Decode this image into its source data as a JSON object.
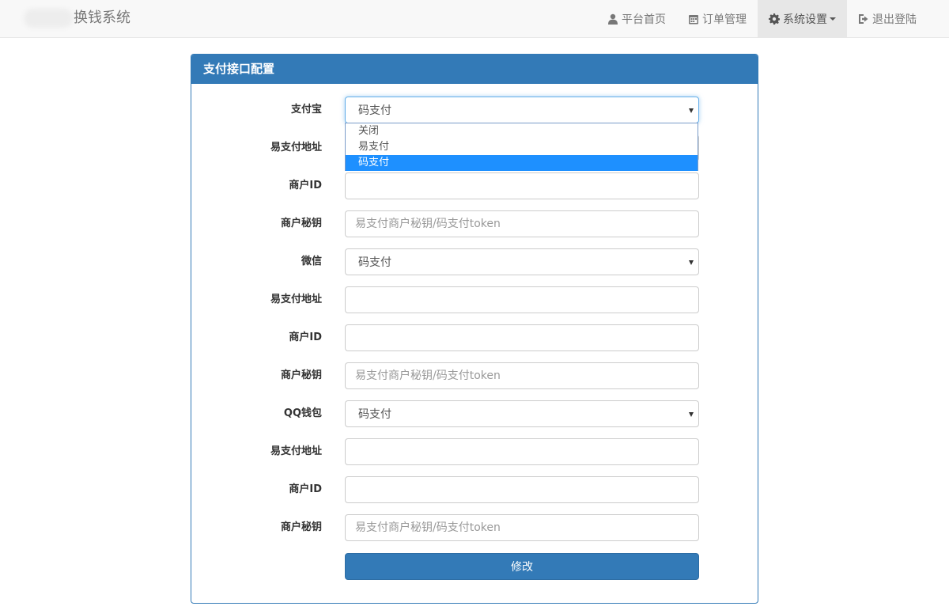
{
  "brand": {
    "title": "换钱系统"
  },
  "nav": {
    "items": [
      {
        "label": "平台首页",
        "icon": "user-icon"
      },
      {
        "label": "订单管理",
        "icon": "calendar-icon"
      },
      {
        "label": "系统设置",
        "icon": "gear-icon",
        "active": true,
        "dropdown": true
      },
      {
        "label": "退出登陆",
        "icon": "logout-icon"
      }
    ]
  },
  "panel": {
    "title": "支付接口配置",
    "alipay": {
      "label": "支付宝",
      "selected": "码支付",
      "options": [
        "关闭",
        "易支付",
        "码支付"
      ],
      "url_label": "易支付地址",
      "url_value": "",
      "id_label": "商户ID",
      "id_value": "",
      "key_label": "商户秘钥",
      "key_placeholder": "易支付商户秘钥/码支付token"
    },
    "wechat": {
      "label": "微信",
      "selected": "码支付",
      "url_label": "易支付地址",
      "url_value": "",
      "id_label": "商户ID",
      "id_value": "",
      "key_label": "商户秘钥",
      "key_placeholder": "易支付商户秘钥/码支付token"
    },
    "qq": {
      "label": "QQ钱包",
      "selected": "码支付",
      "url_label": "易支付地址",
      "url_value": "",
      "id_label": "商户ID",
      "id_value": "",
      "key_label": "商户秘钥",
      "key_placeholder": "易支付商户秘钥/码支付token"
    },
    "submit_label": "修改"
  },
  "colors": {
    "primary": "#337ab7",
    "selected_option": "#1e90ff",
    "navbar_bg": "#f8f8f8"
  }
}
